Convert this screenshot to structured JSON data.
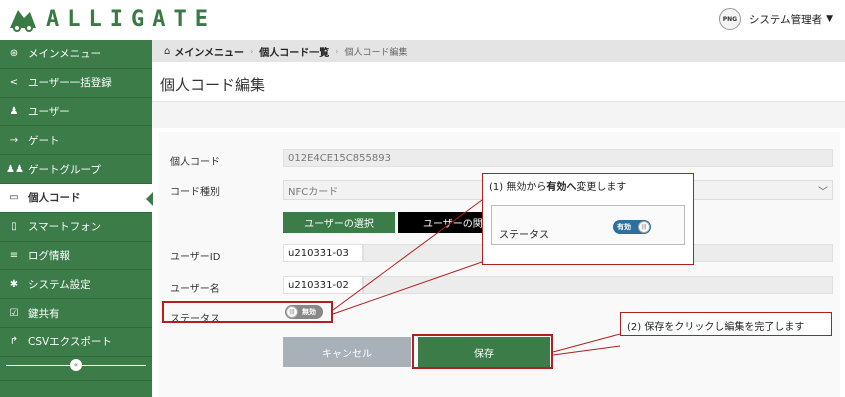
{
  "header": {
    "brand": "ALLIGATE",
    "avatar_text": "PNG",
    "user_name": "システム管理者",
    "caret": "▼"
  },
  "sidebar": {
    "items": [
      {
        "label": "メインメニュー",
        "icon": "dashboard-icon",
        "glyph": "⊛"
      },
      {
        "label": "ユーザー一括登録",
        "icon": "share-icon",
        "glyph": "<"
      },
      {
        "label": "ユーザー",
        "icon": "user-icon",
        "glyph": "♟"
      },
      {
        "label": "ゲート",
        "icon": "sign-in-icon",
        "glyph": "→"
      },
      {
        "label": "ゲートグループ",
        "icon": "users-icon",
        "glyph": "♟♟"
      },
      {
        "label": "個人コード",
        "icon": "card-icon",
        "glyph": "▭"
      },
      {
        "label": "スマートフォン",
        "icon": "mobile-icon",
        "glyph": "▯"
      },
      {
        "label": "ログ情報",
        "icon": "list-icon",
        "glyph": "≡"
      },
      {
        "label": "システム設定",
        "icon": "gear-icon",
        "glyph": "✱"
      },
      {
        "label": "鍵共有",
        "icon": "check-square-icon",
        "glyph": "☑"
      },
      {
        "label": "CSVエクスポート",
        "icon": "share-arrow-icon",
        "glyph": "↱"
      }
    ],
    "active_index": 5,
    "collapse_glyph": "«"
  },
  "breadcrumb": {
    "home": "メインメニュー",
    "parent": "個人コード一覧",
    "current": "個人コード編集",
    "sep": "›",
    "home_glyph": "⌂"
  },
  "page": {
    "title": "個人コード編集"
  },
  "form": {
    "code_label": "個人コード",
    "code_value": "012E4CE15C855893",
    "type_label": "コード種別",
    "type_value": "NFCカード",
    "select_user_button": "ユーザーの選択",
    "related_user_button": "ユーザーの関連",
    "user_id_label": "ユーザーID",
    "user_id_value": "u210331-03",
    "user_name_label": "ユーザー名",
    "user_name_value": "u210331-02",
    "status_label": "ステータス",
    "status_value": "無効",
    "cancel_button": "キャンセル",
    "save_button": "保存",
    "chevron": "﹀"
  },
  "annotations": {
    "step1_prefix": "(1) 無効から",
    "step1_bold": "有効へ",
    "step1_suffix": "変更します",
    "step1_preview_label": "ステータス",
    "step1_preview_status": "有効",
    "step2": "(2) 保存をクリックし編集を完了します",
    "accent_color": "#b21f1f"
  },
  "colors": {
    "brand_green": "#3b7c48",
    "toggle_on": "#2a6f9e",
    "toggle_off": "#888888"
  }
}
